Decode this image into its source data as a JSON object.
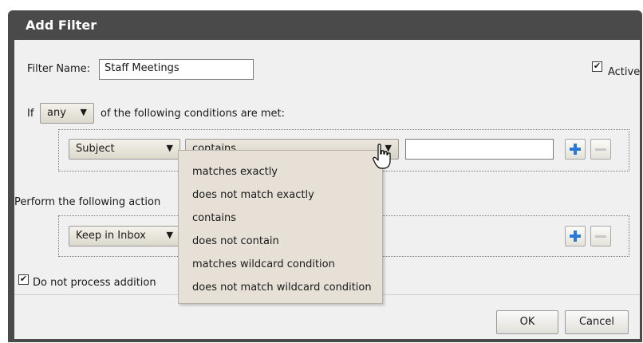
{
  "dialog": {
    "title": "Add Filter"
  },
  "filter_name": {
    "label": "Filter Name:",
    "value": "Staff Meetings"
  },
  "active": {
    "label": "Active",
    "checked": true
  },
  "condition_line": {
    "prefix": "If",
    "match_value": "any",
    "suffix": "of the following conditions are met:"
  },
  "condition_row": {
    "field_value": "Subject",
    "operator_value": "contains",
    "text_value": ""
  },
  "actions": {
    "label": "Perform the following action",
    "action_value": "Keep in Inbox"
  },
  "stop_processing": {
    "label": "Do not process addition",
    "checked": true
  },
  "operator_menu": {
    "items": [
      "matches exactly",
      "does not match exactly",
      "contains",
      "does not contain",
      "matches wildcard condition",
      "does not match wildcard condition"
    ]
  },
  "buttons": {
    "ok": "OK",
    "cancel": "Cancel"
  },
  "icons": {
    "add": "plus-icon",
    "remove": "minus-icon",
    "dropdown": "chevron-down-icon",
    "pointer": "hand-cursor-icon"
  },
  "colors": {
    "titlebar": "#4a4a4a",
    "body": "#f0f0f0",
    "menu": "#e6e0d6",
    "add_icon": "#2a78d8"
  }
}
